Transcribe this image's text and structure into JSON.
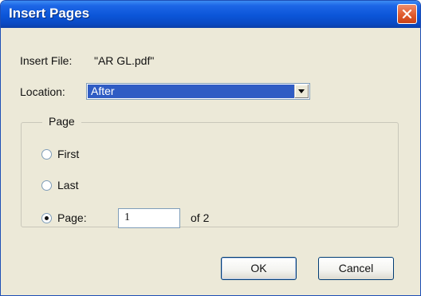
{
  "dialog": {
    "title": "Insert Pages",
    "insert_file_label": "Insert File:",
    "insert_file_value": "\"AR GL.pdf\"",
    "location_label": "Location:",
    "location_value": "After",
    "page_group_title": "Page",
    "options": {
      "first_label": "First",
      "last_label": "Last",
      "page_label": "Page:",
      "selected": "page"
    },
    "page_number": "1",
    "page_total_text": "of 2",
    "ok_label": "OK",
    "cancel_label": "Cancel"
  },
  "colors": {
    "titlebar": "#0b55d8",
    "dialog_bg": "#ece9d8",
    "selection": "#2f5cc4",
    "close_button": "#e05b2d"
  },
  "icons": {
    "close": "close-x-icon",
    "dropdown": "chevron-down-icon"
  }
}
